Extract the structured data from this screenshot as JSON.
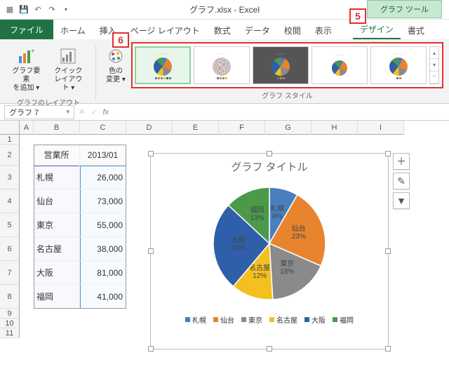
{
  "window": {
    "title": "グラフ.xlsx - Excel",
    "chart_tools": "グラフ ツール"
  },
  "tabs": {
    "file": "ファイル",
    "home": "ホーム",
    "insert": "挿入",
    "pagelayout": "ページ レイアウト",
    "formulas": "数式",
    "data": "データ",
    "review": "校閲",
    "view": "表示",
    "design": "デザイン",
    "format": "書式"
  },
  "callouts": {
    "five": "5",
    "six": "6"
  },
  "ribbon": {
    "add_element": "グラフ要素\nを追加 ▾",
    "quick_layout": "クイック\nレイアウト ▾",
    "change_color": "色の\n変更 ▾",
    "group_layout": "グラフのレイアウト",
    "group_styles": "グラフ スタイル"
  },
  "namebox": "グラフ 7",
  "cols": [
    "A",
    "B",
    "C",
    "D",
    "E",
    "F",
    "G",
    "H",
    "I"
  ],
  "rows": [
    "1",
    "2",
    "3",
    "4",
    "5",
    "6",
    "7",
    "8",
    "9",
    "10",
    "11"
  ],
  "table": {
    "header": {
      "branch": "営業所",
      "month": "2013/01"
    },
    "rows": [
      {
        "branch": "札幌",
        "value": "26,000"
      },
      {
        "branch": "仙台",
        "value": "73,000"
      },
      {
        "branch": "東京",
        "value": "55,000"
      },
      {
        "branch": "名古屋",
        "value": "38,000"
      },
      {
        "branch": "大阪",
        "value": "81,000"
      },
      {
        "branch": "福岡",
        "value": "41,000"
      }
    ]
  },
  "chart": {
    "title": "グラフ タイトル"
  },
  "chart_data": {
    "type": "pie",
    "title": "グラフ タイトル",
    "categories": [
      "札幌",
      "仙台",
      "東京",
      "名古屋",
      "大阪",
      "福岡"
    ],
    "values": [
      26000,
      73000,
      55000,
      38000,
      81000,
      41000
    ],
    "percent_labels": [
      "8%",
      "23%",
      "18%",
      "12%",
      "26%",
      "13%"
    ],
    "colors": [
      "#4a7fbf",
      "#e8842e",
      "#8a8a8a",
      "#f4c020",
      "#2f5fa8",
      "#4a9a4a"
    ],
    "legend_position": "bottom"
  },
  "side_buttons": {
    "add": "＋",
    "brush": "brush-icon",
    "filter": "filter-icon"
  }
}
